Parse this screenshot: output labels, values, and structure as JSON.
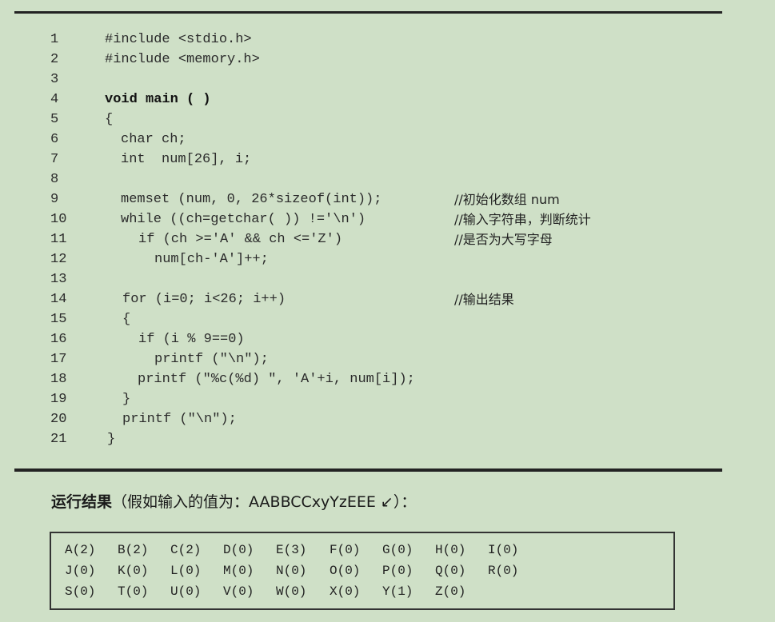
{
  "code": {
    "lines": [
      {
        "number": "1",
        "text": "#include <stdio.h>",
        "comment": ""
      },
      {
        "number": "2",
        "text": "#include <memory.h>",
        "comment": ""
      },
      {
        "number": "3",
        "text": "",
        "comment": ""
      },
      {
        "number": "4",
        "text": "void main ( )",
        "comment": ""
      },
      {
        "number": "5",
        "text": "{",
        "comment": ""
      },
      {
        "number": "6",
        "text": "char ch;",
        "comment": ""
      },
      {
        "number": "7",
        "text": "int  num[26], i;",
        "comment": ""
      },
      {
        "number": "8",
        "text": "",
        "comment": ""
      },
      {
        "number": "9",
        "text": "memset (num, 0, 26*sizeof(int));",
        "comment": "//初始化数组 num"
      },
      {
        "number": "10",
        "text": "while ((ch=getchar( )) !='\\n')",
        "comment": "//输入字符串，判断统计"
      },
      {
        "number": "11",
        "text": "if (ch >='A' && ch <='Z')",
        "comment": "//是否为大写字母"
      },
      {
        "number": "12",
        "text": "num[ch-'A']++;",
        "comment": ""
      },
      {
        "number": "13",
        "text": "",
        "comment": ""
      },
      {
        "number": "14",
        "text": "for (i=0; i<26; i++)",
        "comment": "//输出结果"
      },
      {
        "number": "15",
        "text": "{",
        "comment": ""
      },
      {
        "number": "16",
        "text": "if (i % 9==0)",
        "comment": ""
      },
      {
        "number": "17",
        "text": "printf (\"\\n\");",
        "comment": ""
      },
      {
        "number": "18",
        "text": "printf (\"%c(%d) \", 'A'+i, num[i]);",
        "comment": ""
      },
      {
        "number": "19",
        "text": "}",
        "comment": ""
      },
      {
        "number": "20",
        "text": "printf (\"\\n\");",
        "comment": ""
      },
      {
        "number": "21",
        "text": "}",
        "comment": ""
      }
    ]
  },
  "result": {
    "label": "运行结果",
    "detail": "（假如输入的值为：AABBCCxyYzEEE ↙）：",
    "rows": [
      [
        "A(2)",
        "B(2)",
        "C(2)",
        "D(0)",
        "E(3)",
        "F(0)",
        "G(0)",
        "H(0)",
        "I(0)"
      ],
      [
        "J(0)",
        "K(0)",
        "L(0)",
        "M(0)",
        "N(0)",
        "O(0)",
        "P(0)",
        "Q(0)",
        "R(0)"
      ],
      [
        "S(0)",
        "T(0)",
        "U(0)",
        "V(0)",
        "W(0)",
        "X(0)",
        "Y(1)",
        "Z(0)"
      ]
    ]
  }
}
